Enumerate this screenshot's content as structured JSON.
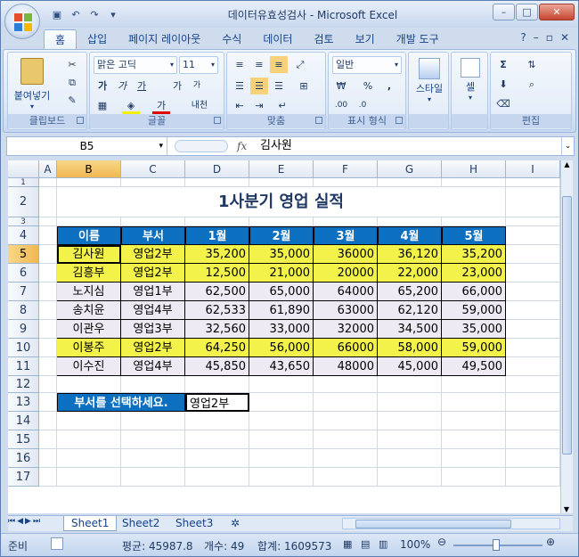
{
  "window": {
    "title": "데이터유효성검사 - Microsoft Excel"
  },
  "tabs": [
    "홈",
    "삽입",
    "페이지 레이아웃",
    "수식",
    "데이터",
    "검토",
    "보기",
    "개발 도구"
  ],
  "active_tab": 0,
  "ribbon": {
    "clipboard": {
      "label": "클립보드",
      "paste": "붙여넣기"
    },
    "font": {
      "label": "글꼴",
      "name": "맑은 고딕",
      "size": "11",
      "bold": "가",
      "italic": "가",
      "underline": "가",
      "grow": "가",
      "shrink": "가",
      "color": "가",
      "phonetic": "내천"
    },
    "alignment": {
      "label": "맞춤"
    },
    "number": {
      "label": "표시 형식",
      "format": "일반",
      "currency": "₩",
      "percent": "%",
      "comma": ",",
      "inc": ".00",
      "dec": ".0"
    },
    "styles": {
      "label": "스타일"
    },
    "cells": {
      "label": "셀"
    },
    "editing": {
      "label": "편집",
      "sum": "Σ"
    }
  },
  "formula_bar": {
    "name_box": "B5",
    "fx": "fx",
    "value": "김사원"
  },
  "columns": [
    "A",
    "B",
    "C",
    "D",
    "E",
    "F",
    "G",
    "H",
    "I"
  ],
  "rows": [
    "1",
    "2",
    "3",
    "4",
    "5",
    "6",
    "7",
    "8",
    "9",
    "10",
    "11",
    "12",
    "13",
    "14",
    "15",
    "16",
    "17"
  ],
  "sheet": {
    "title": "1사분기 영업 실적",
    "headers": [
      "이름",
      "부서",
      "1월",
      "2월",
      "3월",
      "4월",
      "5월"
    ],
    "data": [
      [
        "김사원",
        "영업2부",
        "35,200",
        "35,000",
        "36000",
        "36,120",
        "35,200"
      ],
      [
        "김흥부",
        "영업2부",
        "12,500",
        "21,000",
        "20000",
        "22,000",
        "23,000"
      ],
      [
        "노지심",
        "영업1부",
        "62,500",
        "65,000",
        "64000",
        "65,200",
        "66,000"
      ],
      [
        "송치윤",
        "영업4부",
        "62,533",
        "61,890",
        "63000",
        "62,120",
        "59,000"
      ],
      [
        "이관우",
        "영업3부",
        "32,560",
        "33,000",
        "32000",
        "34,500",
        "35,000"
      ],
      [
        "이봉주",
        "영업2부",
        "64,250",
        "56,000",
        "66000",
        "58,000",
        "59,000"
      ],
      [
        "이수진",
        "영업4부",
        "45,850",
        "43,650",
        "48000",
        "45,000",
        "49,500"
      ]
    ],
    "highlight_rows": [
      0,
      1,
      5
    ],
    "prompt_label": "부서를 선택하세요.",
    "prompt_value": "영업2부"
  },
  "sheet_tabs": [
    "Sheet1",
    "Sheet2",
    "Sheet3"
  ],
  "status": {
    "ready": "준비",
    "average": "평균: 45987.8",
    "count": "개수: 49",
    "sum": "합계: 1609573",
    "zoom": "100%"
  },
  "colors": {
    "header_fill": "#0d6fbf",
    "highlight": "#f2f24a",
    "row_band": "#edeaf3",
    "title_text": "#1f3864"
  }
}
